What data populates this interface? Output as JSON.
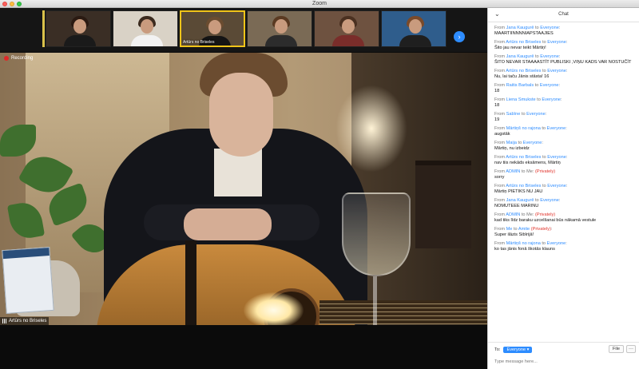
{
  "window": {
    "title": "Zoom"
  },
  "gallery": {
    "thumbnails": [
      {
        "label": "",
        "bg": "#3a2e25",
        "hair": "#2a1a12",
        "body": "#1a1a1a",
        "active": false
      },
      {
        "label": "",
        "bg": "#d9d2c6",
        "hair": "#3b2a1e",
        "body": "#f2f2f2",
        "active": false
      },
      {
        "label": "Artūrs no Briseles",
        "bg": "#5a4a36",
        "hair": "#6b4c30",
        "body": "#141414",
        "active": true
      },
      {
        "label": "",
        "bg": "#7a6a55",
        "hair": "#5a3a22",
        "body": "#2c2c2c",
        "active": false
      },
      {
        "label": "",
        "bg": "#6e5240",
        "hair": "#4a3020",
        "body": "#7a2d2a",
        "active": false
      },
      {
        "label": "",
        "bg": "#2f5d8c",
        "hair": "#7a4a2a",
        "body": "#1f1f1f",
        "active": false
      }
    ]
  },
  "video": {
    "recording_label": "Recording",
    "speaker_name": "Artūrs no Briseles"
  },
  "chat": {
    "title": "Chat",
    "messages": [
      {
        "prefix": "From ",
        "from": "Jana Kaugurē",
        "mid": " to ",
        "to": "Everyone",
        "private": "",
        "text": "MAARTIINNNNIAPSTAAJIES"
      },
      {
        "prefix": "From ",
        "from": "Artūrs no Briseles",
        "mid": " to ",
        "to": "Everyone",
        "private": "",
        "text": "Šito jau nevar teikt Mārtiņ!"
      },
      {
        "prefix": "From ",
        "from": "Jana Kaugurē",
        "mid": " to ",
        "to": "Everyone",
        "private": "",
        "text": "ŠITO NEVAR STAAAASTĪT PUBLISKI ,VIŅU KADS VAR NOSTUČĪT"
      },
      {
        "prefix": "From ",
        "from": "Artūrs no Briseles",
        "mid": " to ",
        "to": "Everyone",
        "private": "",
        "text": "Nu, lai taču Jānis stāsta! 16"
      },
      {
        "prefix": "From ",
        "from": "Raitis Barbals",
        "mid": " to ",
        "to": "Everyone",
        "private": "",
        "text": "18"
      },
      {
        "prefix": "From ",
        "from": "Liena Smukste",
        "mid": " to ",
        "to": "Everyone",
        "private": "",
        "text": "18"
      },
      {
        "prefix": "From ",
        "from": "Sabīne",
        "mid": " to ",
        "to": "Everyone",
        "private": "",
        "text": "19"
      },
      {
        "prefix": "From ",
        "from": "Mārtiņš no rajona",
        "mid": " to ",
        "to": "Everyone",
        "private": "",
        "text": "augstāk"
      },
      {
        "prefix": "From ",
        "from": "Maija",
        "mid": " to ",
        "to": "Everyone",
        "private": "",
        "text": "Mārtiņ, nu izbeidz"
      },
      {
        "prefix": "From ",
        "from": "Artūrs no Briseles",
        "mid": " to ",
        "to": "Everyone",
        "private": "",
        "text": "nav tiis nekāds eksāmens, Mārtiņ"
      },
      {
        "prefix": "From ",
        "from": "ADMIN",
        "mid": " to Me: ",
        "to": "",
        "private": "(Privately)",
        "text": "sorry"
      },
      {
        "prefix": "From ",
        "from": "Artūrs no Briseles",
        "mid": " to ",
        "to": "Everyone",
        "private": "",
        "text": "Mārtiņ PIETIKS NU JAU"
      },
      {
        "prefix": "From ",
        "from": "Jana Kaugurē",
        "mid": " to ",
        "to": "Everyone",
        "private": "",
        "text": "NOMUTEEE MARINU"
      },
      {
        "prefix": "From ",
        "from": "ADMIN",
        "mid": " to Me: ",
        "to": "",
        "private": "(Privately)",
        "text": "kad tiks līdz baraku uzcelšanai  būs nākamā vestule"
      },
      {
        "prefix": "From ",
        "from": "Me",
        "mid": " to ",
        "to": "Amite",
        "private": "(Privately)",
        "text": "Super ilāzis Sibīrijā!"
      },
      {
        "prefix": "From ",
        "from": "Mārtiņš no rajona",
        "mid": " to ",
        "to": "Everyone",
        "private": "",
        "text": "ko tas jānis fonā škotās klauns"
      }
    ],
    "to_label": "To:",
    "to_value": "Everyone",
    "file_label": "File",
    "more_label": "···",
    "input_placeholder": "Type message here..."
  },
  "colors": {
    "accent": "#2d8cff",
    "private": "#e0322a",
    "recording": "#e02828",
    "active_speaker_border": "#f0c419"
  },
  "icons": {
    "collapse": "chevron-down-icon",
    "next_page": "chevron-right-icon",
    "recording": "record-dot-icon",
    "signal": "signal-bars-icon"
  }
}
